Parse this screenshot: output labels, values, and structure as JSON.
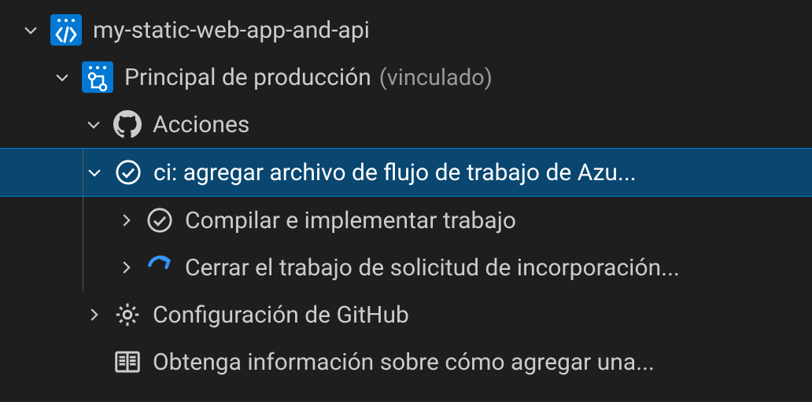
{
  "root": {
    "label": "my-static-web-app-and-api"
  },
  "env": {
    "label": "Principal de producción",
    "status": "(vinculado)"
  },
  "actions": {
    "label": "Acciones"
  },
  "workflow": {
    "label": "ci: agregar archivo de flujo de trabajo de Azu..."
  },
  "job_build": {
    "label": "Compilar e implementar trabajo"
  },
  "job_close": {
    "label": "Cerrar el trabajo de solicitud de incorporación..."
  },
  "gh_config": {
    "label": "Configuración de GitHub"
  },
  "learn": {
    "label": "Obtenga información sobre cómo agregar una..."
  }
}
